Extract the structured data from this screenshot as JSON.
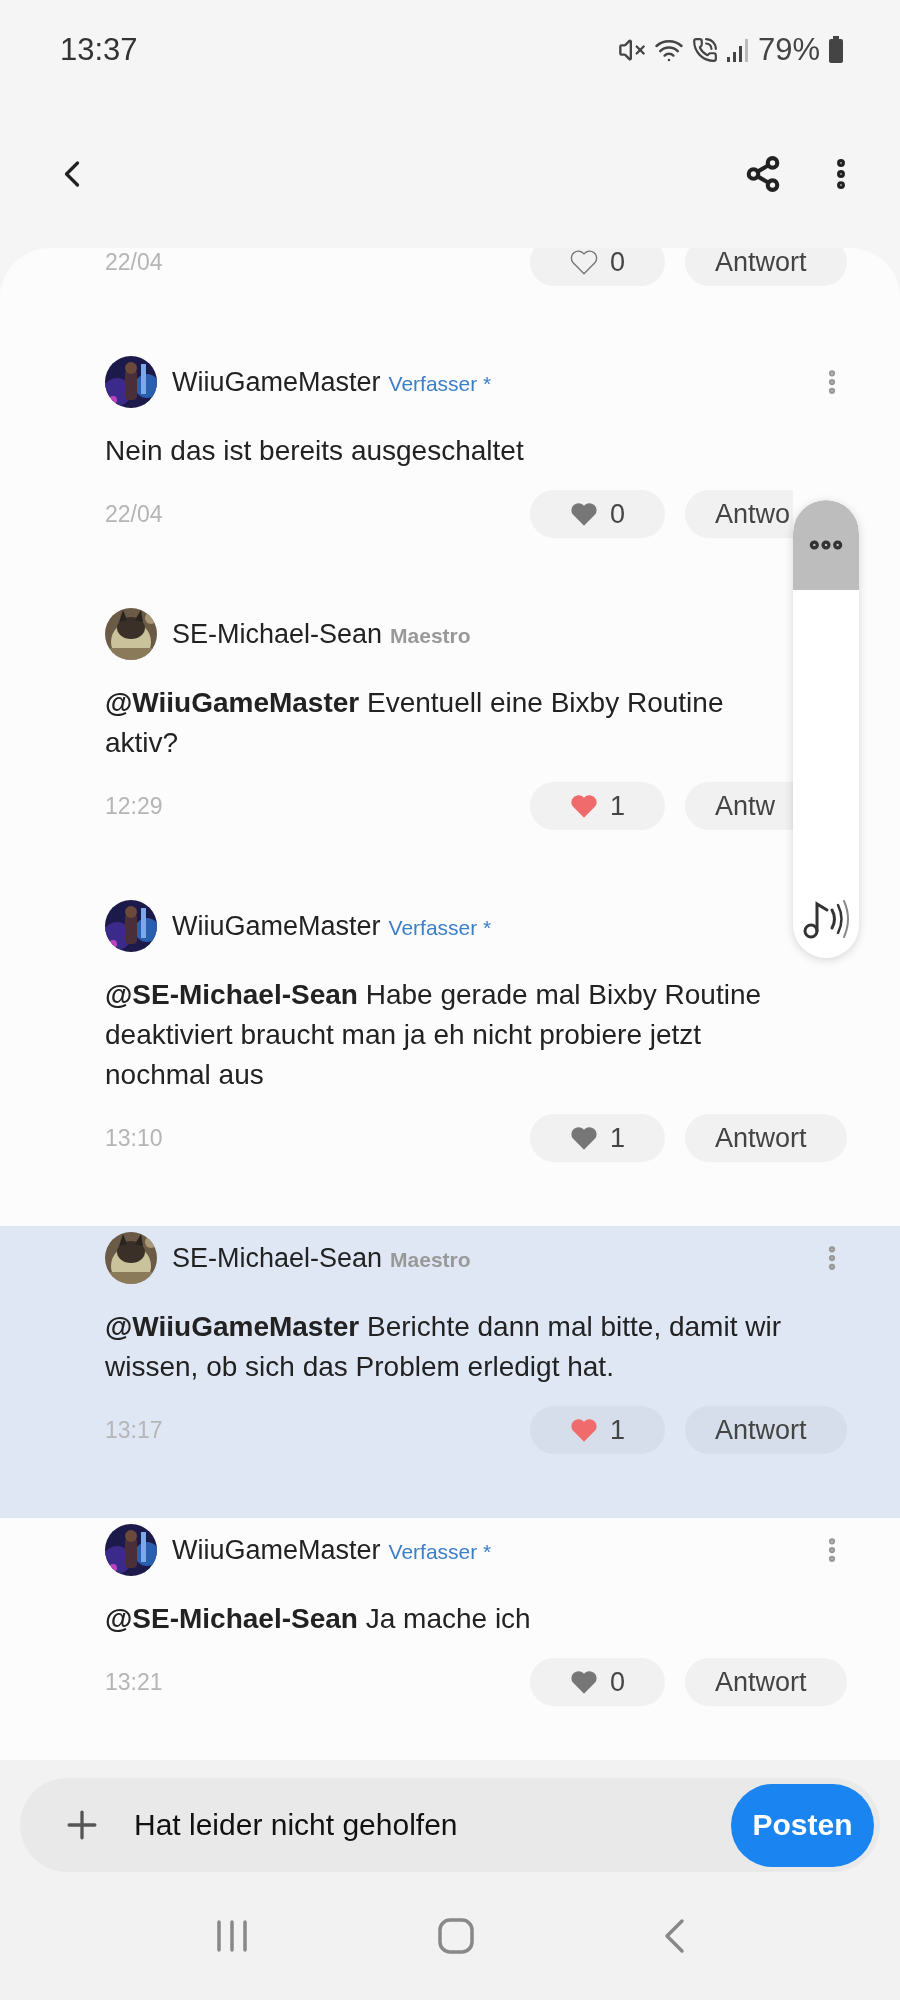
{
  "status_bar": {
    "time": "13:37",
    "battery": "79%"
  },
  "previous_footer": {
    "date": "22/04",
    "like": {
      "count": "0",
      "outline": true
    },
    "reply": "Antwort"
  },
  "comments": [
    {
      "author": "WiiuGameMaster",
      "role": {
        "text": "Verfasser *",
        "kind": "author"
      },
      "has_menu": true,
      "highlighted": false,
      "body": "Nein das ist bereits ausgeschaltet",
      "date": "22/04",
      "like": {
        "count": "0",
        "liked": false,
        "outline": false
      },
      "reply": "Antwo",
      "reply_covered": true
    },
    {
      "author": "SE-Michael-Sean",
      "role": {
        "text": "Maestro",
        "kind": "rank"
      },
      "has_menu": false,
      "highlighted": false,
      "body": "**@WiiuGameMaster** Eventuell eine Bixby Routine aktiv?",
      "date": "12:29",
      "like": {
        "count": "1",
        "liked": true,
        "outline": false
      },
      "reply": "Antw",
      "reply_covered": true
    },
    {
      "author": "WiiuGameMaster",
      "role": {
        "text": "Verfasser *",
        "kind": "author"
      },
      "has_menu": false,
      "highlighted": false,
      "body": "**@SE-Michael-Sean** Habe gerade mal Bixby Routine deaktiviert braucht man ja eh nicht probiere jetzt nochmal aus",
      "date": "13:10",
      "like": {
        "count": "1",
        "liked": false,
        "outline": false
      },
      "reply": "Antwort"
    },
    {
      "author": "SE-Michael-Sean",
      "role": {
        "text": "Maestro",
        "kind": "rank"
      },
      "has_menu": true,
      "highlighted": true,
      "body": "**@WiiuGameMaster** Berichte dann mal bitte, damit wir wissen, ob sich das Problem erledigt hat.",
      "date": "13:17",
      "like": {
        "count": "1",
        "liked": true,
        "outline": false
      },
      "reply": "Antwort"
    },
    {
      "author": "WiiuGameMaster",
      "role": {
        "text": "Verfasser *",
        "kind": "author"
      },
      "has_menu": true,
      "highlighted": false,
      "body": "**@SE-Michael-Sean** Ja mache ich",
      "date": "13:21",
      "like": {
        "count": "0",
        "liked": false,
        "outline": false
      },
      "reply": "Antwort"
    }
  ],
  "composer": {
    "value": "Hat leider nicht geholfen",
    "button": "Posten"
  }
}
